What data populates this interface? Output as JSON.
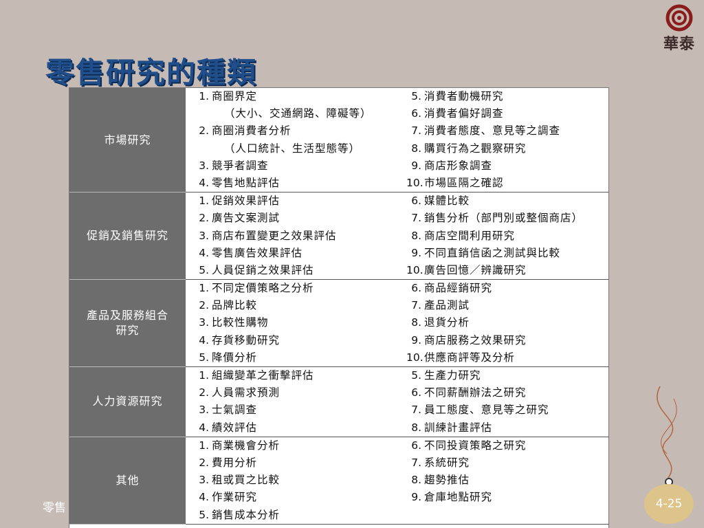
{
  "header": {
    "brand": "華泰",
    "title": "零售研究的種類"
  },
  "footer": {
    "text": "零售",
    "page_number": "4-25"
  },
  "table": {
    "sections": [
      {
        "category": "市場研究",
        "left": [
          {
            "num": "1.",
            "text": "商圈界定"
          },
          {
            "num": "",
            "text": "（大小、交通網路、障礙等）"
          },
          {
            "num": "2.",
            "text": "商圈消費者分析"
          },
          {
            "num": "",
            "text": "（人口統計、生活型態等）"
          },
          {
            "num": "3.",
            "text": "競爭者調查"
          },
          {
            "num": "4.",
            "text": "零售地點評估"
          }
        ],
        "right": [
          {
            "num": "5.",
            "text": "消費者動機研究"
          },
          {
            "num": "6.",
            "text": "消費者偏好調查"
          },
          {
            "num": "7.",
            "text": "消費者態度、意見等之調查"
          },
          {
            "num": "8.",
            "text": "購買行為之觀察研究"
          },
          {
            "num": "9.",
            "text": "商店形象調查"
          },
          {
            "num": "10.",
            "text": "市場區隔之確認"
          }
        ]
      },
      {
        "category": "促銷及銷售研究",
        "left": [
          {
            "num": "1.",
            "text": "促銷效果評估"
          },
          {
            "num": "2.",
            "text": "廣告文案測試"
          },
          {
            "num": "3.",
            "text": "商店布置變更之效果評估"
          },
          {
            "num": "4.",
            "text": "零售廣告效果評估"
          },
          {
            "num": "5.",
            "text": "人員促銷之效果評估"
          }
        ],
        "right": [
          {
            "num": "6.",
            "text": "媒體比較"
          },
          {
            "num": "7.",
            "text": "銷售分析（部門別或整個商店）"
          },
          {
            "num": "8.",
            "text": "商店空間利用研究"
          },
          {
            "num": "9.",
            "text": "不同直銷信函之測試與比較"
          },
          {
            "num": "10.",
            "text": "廣告回憶／辨識研究"
          }
        ]
      },
      {
        "category_line1": "產品及服務組合",
        "category_line2": "研究",
        "left": [
          {
            "num": "1.",
            "text": "不同定價策略之分析"
          },
          {
            "num": "2.",
            "text": "品牌比較"
          },
          {
            "num": "3.",
            "text": "比較性購物"
          },
          {
            "num": "4.",
            "text": "存貨移動研究"
          },
          {
            "num": "5.",
            "text": "降價分析"
          }
        ],
        "right": [
          {
            "num": "6.",
            "text": "商品經銷研究"
          },
          {
            "num": "7.",
            "text": "產品測試"
          },
          {
            "num": "8.",
            "text": "退貨分析"
          },
          {
            "num": "9.",
            "text": "商店服務之效果研究"
          },
          {
            "num": "10.",
            "text": "供應商評等及分析"
          }
        ]
      },
      {
        "category": "人力資源研究",
        "left": [
          {
            "num": "1.",
            "text": "組織變革之衝擊評估"
          },
          {
            "num": "2.",
            "text": "人員需求預測"
          },
          {
            "num": "3.",
            "text": "士氣調查"
          },
          {
            "num": "4.",
            "text": "績效評估"
          }
        ],
        "right": [
          {
            "num": "5.",
            "text": "生產力研究"
          },
          {
            "num": "6.",
            "text": "不同薪酬辦法之研究"
          },
          {
            "num": "7.",
            "text": "員工態度、意見等之研究"
          },
          {
            "num": "8.",
            "text": "訓練計畫評估"
          }
        ]
      },
      {
        "category": "其他",
        "left": [
          {
            "num": "1.",
            "text": "商業機會分析"
          },
          {
            "num": "2.",
            "text": "費用分析"
          },
          {
            "num": "3.",
            "text": "租或買之比較"
          },
          {
            "num": "4.",
            "text": "作業研究"
          },
          {
            "num": "5.",
            "text": "銷售成本分析"
          }
        ],
        "right": [
          {
            "num": "6.",
            "text": "不同投資策略之研究"
          },
          {
            "num": "7.",
            "text": "系統研究"
          },
          {
            "num": "8.",
            "text": "趨勢推估"
          },
          {
            "num": "9.",
            "text": "倉庫地點研究"
          }
        ]
      }
    ]
  },
  "colors": {
    "background": "#c6bbb4",
    "title": "#1f4e8a",
    "category_cell": "#6d6d6d",
    "badge": "#dcc48a"
  }
}
